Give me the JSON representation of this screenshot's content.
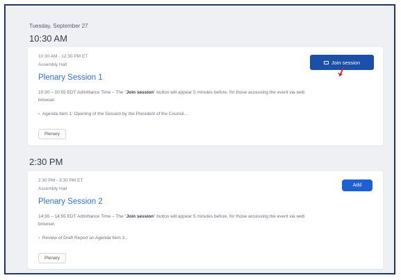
{
  "date_label": "Tuesday, September 27",
  "sessions": [
    {
      "time_heading": "10:30 AM",
      "range": "10:30 AM - 12:30 PM ET",
      "location": "Assembly Hall",
      "title": "Plenary Session 1",
      "desc_prefix": "10:30 – 10:55 EDT Admittance Time – The \"",
      "desc_bold": "Join session",
      "desc_suffix": "\" button will appear 5 minutes before, for those accessing the event via web browser.",
      "agenda": "Agenda Item 1: Opening of the Session by the President of the Council...",
      "tag": "Plenary",
      "action_label": "Join session"
    },
    {
      "time_heading": "2:30 PM",
      "range": "2:30 PM - 3:30 PM ET",
      "location": "Assembly Hall",
      "title": "Plenary Session 2",
      "desc_prefix": "14:30 – 14:55 EDT Admittance Time – The \"",
      "desc_bold": "Join session",
      "desc_suffix": "\" button will appear 5 minutes before, for those accessing the event via web browser.",
      "agenda": "Review of Draft Report on Agenda Item 3...",
      "tag": "Plenary",
      "action_label": "Add"
    }
  ],
  "icons": {
    "join": "video-camera-icon",
    "cursor": "mouse-cursor-icon"
  },
  "colors": {
    "join_button": "#1b4fa8",
    "add_button": "#1e5fd6",
    "title_link": "#2e6fd8",
    "cursor": "#d0202a"
  }
}
